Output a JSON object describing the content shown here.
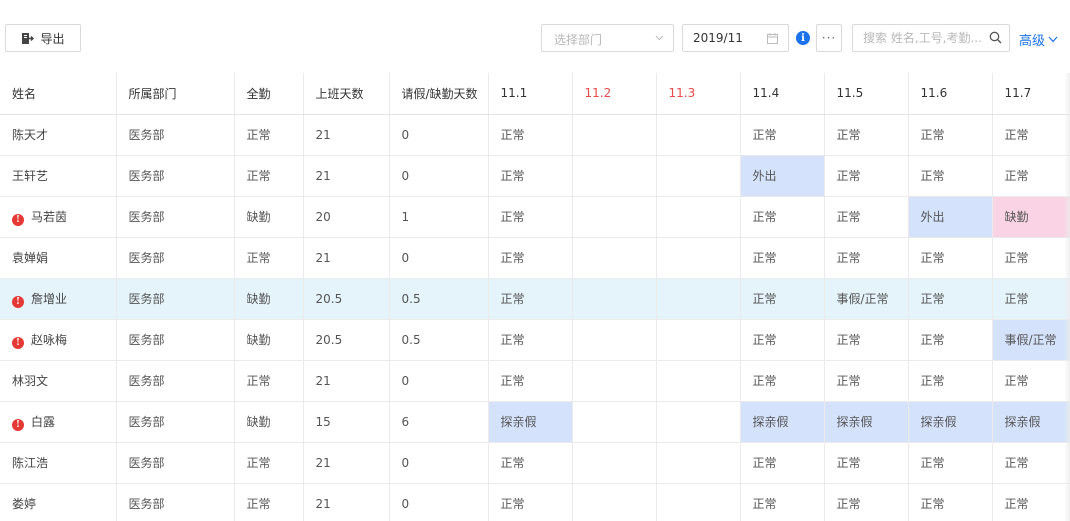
{
  "toolbar": {
    "export_label": "导出",
    "dept_placeholder": "选择部门",
    "month_value": "2019/11",
    "search_placeholder": "搜索 姓名,工号,考勤...",
    "more_label": "···",
    "advanced_label": "高级"
  },
  "colors": {
    "accent": "#1a73e8",
    "holiday_header": "#e64a4a",
    "warning": "#e53935",
    "status_blue": "#d4e3fb",
    "status_pink": "#fad4e4",
    "row_highlight": "#e5f4fb"
  },
  "table": {
    "columns": [
      "姓名",
      "所属部门",
      "全勤",
      "上班天数",
      "请假/缺勤天数",
      "11.1",
      "11.2",
      "11.3",
      "11.4",
      "11.5",
      "11.6",
      "11.7"
    ],
    "holiday_columns": [
      "11.2",
      "11.3"
    ],
    "rows": [
      {
        "name": "陈天才",
        "warn": false,
        "dept": "医务部",
        "full": "正常",
        "work_days": "21",
        "leave_days": "0",
        "d1": "正常",
        "d2": "",
        "d3": "",
        "d4": "正常",
        "d5": "正常",
        "d6": "正常",
        "d7": "正常"
      },
      {
        "name": "王轩艺",
        "warn": false,
        "dept": "医务部",
        "full": "正常",
        "work_days": "21",
        "leave_days": "0",
        "d1": "正常",
        "d2": "",
        "d3": "",
        "d4": "外出",
        "d5": "正常",
        "d6": "正常",
        "d7": "正常"
      },
      {
        "name": "马若茵",
        "warn": true,
        "dept": "医务部",
        "full": "缺勤",
        "work_days": "20",
        "leave_days": "1",
        "d1": "正常",
        "d2": "",
        "d3": "",
        "d4": "正常",
        "d5": "正常",
        "d6": "外出",
        "d7": "缺勤"
      },
      {
        "name": "袁婵娟",
        "warn": false,
        "dept": "医务部",
        "full": "正常",
        "work_days": "21",
        "leave_days": "0",
        "d1": "正常",
        "d2": "",
        "d3": "",
        "d4": "正常",
        "d5": "正常",
        "d6": "正常",
        "d7": "正常"
      },
      {
        "name": "詹增业",
        "warn": true,
        "dept": "医务部",
        "full": "缺勤",
        "work_days": "20.5",
        "leave_days": "0.5",
        "d1": "正常",
        "d2": "",
        "d3": "",
        "d4": "正常",
        "d5": "事假/正常",
        "d6": "正常",
        "d7": "正常"
      },
      {
        "name": "赵咏梅",
        "warn": true,
        "dept": "医务部",
        "full": "缺勤",
        "work_days": "20.5",
        "leave_days": "0.5",
        "d1": "正常",
        "d2": "",
        "d3": "",
        "d4": "正常",
        "d5": "正常",
        "d6": "正常",
        "d7": "事假/正常"
      },
      {
        "name": "林羽文",
        "warn": false,
        "dept": "医务部",
        "full": "正常",
        "work_days": "21",
        "leave_days": "0",
        "d1": "正常",
        "d2": "",
        "d3": "",
        "d4": "正常",
        "d5": "正常",
        "d6": "正常",
        "d7": "正常"
      },
      {
        "name": "白露",
        "warn": true,
        "dept": "医务部",
        "full": "缺勤",
        "work_days": "15",
        "leave_days": "6",
        "d1": "探亲假",
        "d2": "",
        "d3": "",
        "d4": "探亲假",
        "d5": "探亲假",
        "d6": "探亲假",
        "d7": "探亲假"
      },
      {
        "name": "陈江浩",
        "warn": false,
        "dept": "医务部",
        "full": "正常",
        "work_days": "21",
        "leave_days": "0",
        "d1": "正常",
        "d2": "",
        "d3": "",
        "d4": "正常",
        "d5": "正常",
        "d6": "正常",
        "d7": "正常"
      },
      {
        "name": "娄婷",
        "warn": false,
        "dept": "医务部",
        "full": "正常",
        "work_days": "21",
        "leave_days": "0",
        "d1": "正常",
        "d2": "",
        "d3": "",
        "d4": "正常",
        "d5": "正常",
        "d6": "正常",
        "d7": "正常"
      }
    ],
    "highlighted_row": "詹增业"
  }
}
